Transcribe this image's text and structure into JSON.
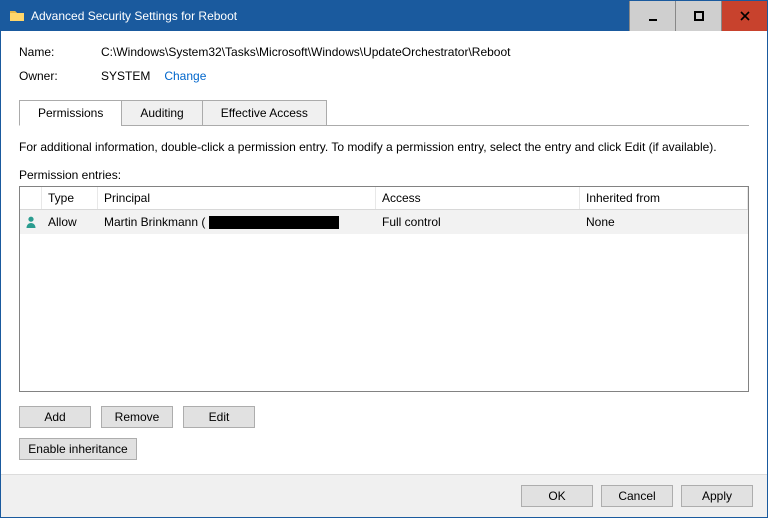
{
  "window": {
    "title": "Advanced Security Settings for Reboot"
  },
  "fields": {
    "name_label": "Name:",
    "name_value": "C:\\Windows\\System32\\Tasks\\Microsoft\\Windows\\UpdateOrchestrator\\Reboot",
    "owner_label": "Owner:",
    "owner_value": "SYSTEM",
    "change_link": "Change"
  },
  "tabs": {
    "permissions": "Permissions",
    "auditing": "Auditing",
    "effective": "Effective Access"
  },
  "body": {
    "info_text": "For additional information, double-click a permission entry. To modify a permission entry, select the entry and click Edit (if available).",
    "entries_label": "Permission entries:"
  },
  "grid": {
    "headers": {
      "type": "Type",
      "principal": "Principal",
      "access": "Access",
      "inherited": "Inherited from"
    },
    "rows": [
      {
        "type": "Allow",
        "principal_name": "Martin Brinkmann (",
        "access": "Full control",
        "inherited": "None"
      }
    ]
  },
  "buttons": {
    "add": "Add",
    "remove": "Remove",
    "edit": "Edit",
    "enable_inheritance": "Enable inheritance",
    "ok": "OK",
    "cancel": "Cancel",
    "apply": "Apply"
  }
}
